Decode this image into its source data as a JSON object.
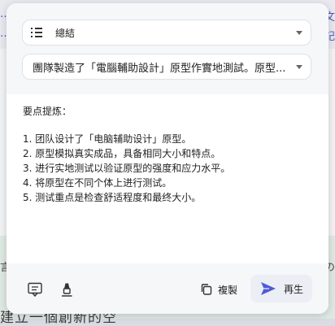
{
  "background": {
    "edge_texts": [
      "…",
      "文",
      "…",
      "記",
      "言",
      "の"
    ],
    "bottom_line": "建立一個創新的空"
  },
  "mode_select": {
    "label": "總結"
  },
  "prompt_select": {
    "value": "團隊製造了「電腦輔助設計」原型作實地測試。原型..."
  },
  "output": {
    "heading": "要点提炼：",
    "lines": [
      "1. 团队设计了「电脑辅助设计」原型。",
      "2. 原型模拟真实成品，具备相同大小和特点。",
      "3. 进行实地测试以验证原型的强度和应力水平。",
      "4. 将原型在不同个体上进行测试。",
      "5. 测试重点是检查舒适程度和最终大小。"
    ]
  },
  "footer": {
    "copy_label": "複製",
    "regenerate_label": "再生",
    "accent": "#4f5bd5"
  },
  "icons": [
    "list-icon",
    "chevron-down-icon",
    "feedback-icon",
    "highlighter-icon",
    "copy-icon",
    "send-icon"
  ]
}
